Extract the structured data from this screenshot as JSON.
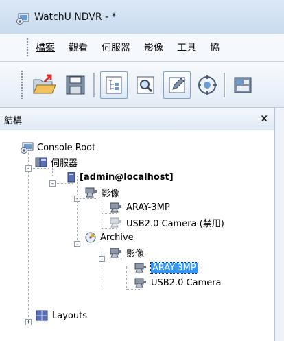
{
  "window": {
    "title": "WatchU NDVR - *"
  },
  "menu": [
    {
      "label": "檔案"
    },
    {
      "label": "觀看"
    },
    {
      "label": "伺服器"
    },
    {
      "label": "影像"
    },
    {
      "label": "工具"
    },
    {
      "label": "協"
    }
  ],
  "toolbar": {
    "buttons": [
      {
        "icon": "open-folder-icon"
      },
      {
        "icon": "save-icon"
      },
      {
        "icon": "tree-view-icon"
      },
      {
        "icon": "zoom-view-icon"
      },
      {
        "icon": "edit-icon"
      },
      {
        "icon": "navigate-icon"
      },
      {
        "icon": "layout-icon"
      }
    ]
  },
  "panel": {
    "title": "結構",
    "close_label": "x"
  },
  "tree": {
    "console_root": "Console Root",
    "servers": "伺服器",
    "server_host": "[admin@localhost]",
    "images1": "影像",
    "camera1": "ARAY-3MP",
    "camera2": "USB2.0 Camera (禁用)",
    "archive": "Archive",
    "images2": "影像",
    "archive_camera1": "ARAY-3MP",
    "archive_camera2": "USB2.0 Camera",
    "layouts": "Layouts"
  }
}
